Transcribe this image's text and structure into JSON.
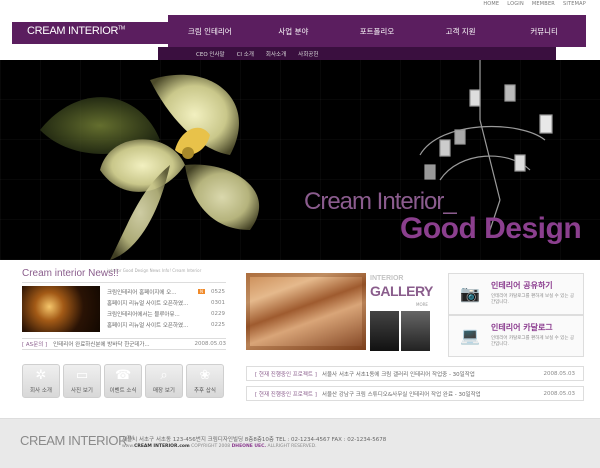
{
  "top_links": [
    "HOME",
    "LOGIN",
    "MEMBER",
    "SITEMAP"
  ],
  "logo": {
    "text": "CREAM INTERIOR",
    "mark": "TM"
  },
  "nav": {
    "main": [
      "크림 인테리어",
      "사업 분야",
      "포트폴리오",
      "고객 지원",
      "커뮤니티"
    ],
    "sub": [
      "CEO 인사말",
      "CI 소개",
      "회사소개",
      "사회공헌"
    ]
  },
  "hero": {
    "subtitle": "Cream Interior_",
    "title": "Good Design"
  },
  "news": {
    "title": "Cream interior News!!",
    "note": "interior Good Design News Info! Cream Interior",
    "items": [
      {
        "title": "크림인테리어 홈페이지에 오...",
        "date": "0525",
        "badge": "N"
      },
      {
        "title": "홈페이지 리뉴얼 사이트 오픈하였...",
        "date": "0301"
      },
      {
        "title": "크림인테리어에서는 블루아뮤...",
        "date": "0229"
      },
      {
        "title": "홈페이지 리뉴얼 사이트 오픈하였...",
        "date": "0225"
      }
    ],
    "as": {
      "label": "[ AS문의 ]",
      "text": "인테리어 완료하신분에 방바닥 한군데가...",
      "date": "2008.05.03"
    }
  },
  "quick": [
    "회사 소개",
    "사진 보기",
    "이벤트 소식",
    "매장 보기",
    "추후 삽식"
  ],
  "gallery": {
    "label_top": "INTERIOR",
    "label": "GALLERY",
    "more": "MORE"
  },
  "promo": [
    {
      "title": "인테리어 공유하기",
      "desc": "인테리어 카탈로그를 편하게 보실 수 있는 공간입니다."
    },
    {
      "title": "인테리어 카달로그",
      "desc": "인테리어 카탈로그를 편하게 보실 수 있는 공간입니다."
    }
  ],
  "projects": [
    {
      "label": "[ 현재 진행중인 프로젝트 ]",
      "text": "서울사 서초구 서초1동에 크림 갤러리 인테리어 작업중 - 30일작업",
      "date": "2008.05.03"
    },
    {
      "label": "[ 현재 진행중인 프로젝트 ]",
      "text": "서울산 강남구 크림 스튜디오&사무실 인테리어 작업 완료 - 30일작업",
      "date": "2008.05.03"
    }
  ],
  "footer": {
    "logo": "CREAM INTERIOR",
    "mark": "TM",
    "address": "서울시 서초구 서초동 123-456번지 크림디자인빌딩 8층8층10층   TEL : 02-1234-4567   FAX : 02-1234-5678",
    "copyright_prefix": "www.",
    "copyright_site": "CREAM INTERIOR.com",
    "copyright_rest": "COPYRIGHT 2008 ",
    "copyright_owner": "DHEONE UEC.",
    "copyright_suffix": " ALLRIGHT RESERVED."
  }
}
